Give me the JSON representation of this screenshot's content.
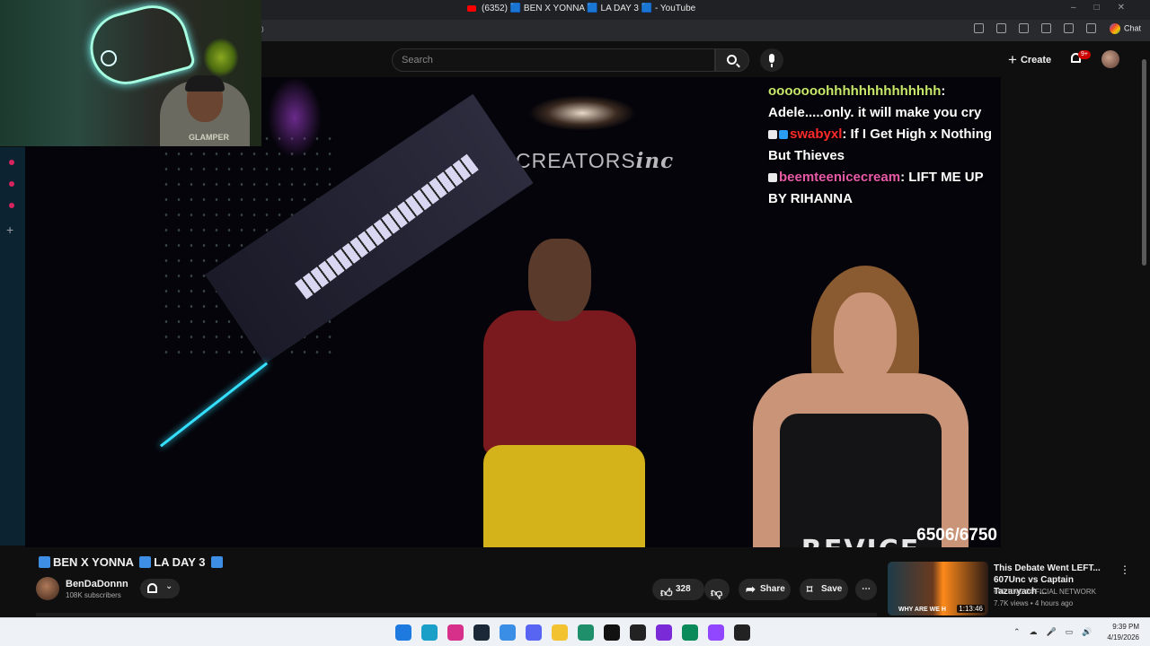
{
  "browser": {
    "tab_title": "(6352) 🟦 BEN X YONNA 🟦 LA DAY 3 🟦 - YouTube",
    "url_fragment": "/0",
    "chat_label": "Chat"
  },
  "header": {
    "search_placeholder": "Search",
    "create_label": "Create",
    "notification_count": "9+"
  },
  "video": {
    "studio_logo_text": "CREATORS",
    "studio_logo_italic": "inc",
    "shirt_text": "REVICE",
    "counter": "6506/6750",
    "webcam_shirt": "GLAMPER"
  },
  "chat_overlay": {
    "messages": [
      {
        "user": "ooooooohhhhhhhhhhhhhh",
        "text": "Adele.....only. it will make you cry"
      },
      {
        "user": "swabyxl",
        "text": "If I Get High x Nothing But Thieves"
      },
      {
        "user": "beemteenicecream",
        "text": "LIFT ME UP BY RIHANNA"
      }
    ],
    "colors": {
      "user1": "#c8e86a",
      "user2": "#ff2a2a",
      "user3": "#e85aa8"
    }
  },
  "watch": {
    "title_part1": "BEN X YONNA",
    "title_part2": "LA DAY 3",
    "channel_name": "BenDaDonnn",
    "subscribers": "108K subscribers",
    "likes": "328",
    "share_label": "Share",
    "save_label": "Save"
  },
  "recommendation": {
    "title": "This Debate Went LEFT... 607Unc vs Captain Tazaryach ...",
    "channel": "607 UNC OFFICIAL NETWORK",
    "meta": "7.7K views • 4 hours ago",
    "duration": "1:13:46",
    "thumb_caption": "WHY ARE WE H"
  },
  "taskbar": {
    "time": "9:39 PM",
    "date": "4/19/2026"
  },
  "icons": [
    "search-icon",
    "mic-icon",
    "bell-icon",
    "like-icon",
    "dislike-icon",
    "share-icon",
    "save-icon",
    "more-icon"
  ]
}
